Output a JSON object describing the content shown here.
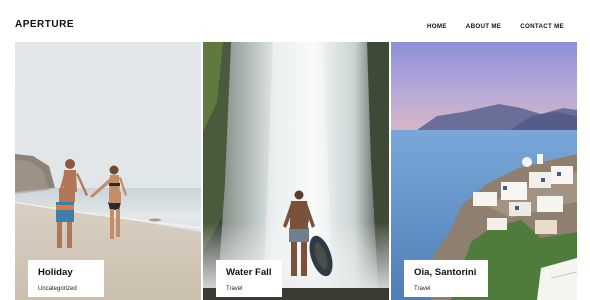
{
  "site": {
    "logo": "APERTURE"
  },
  "nav": {
    "items": [
      "HOME",
      "ABOUT ME",
      "CONTACT ME"
    ]
  },
  "posts": [
    {
      "title": "Holiday",
      "category": "Uncategorized"
    },
    {
      "title": "Water Fall",
      "category": "Travel"
    },
    {
      "title": "Oia, Santorini",
      "category": "Travel"
    }
  ]
}
